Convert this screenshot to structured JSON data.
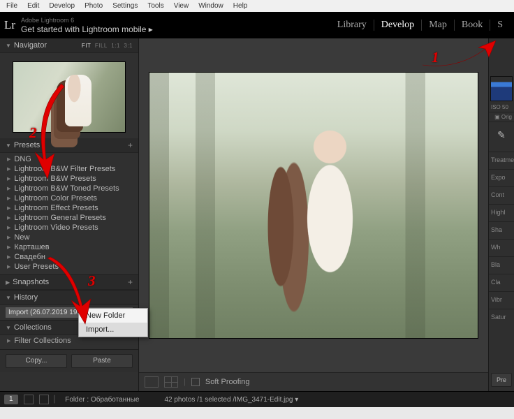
{
  "menubar": [
    "File",
    "Edit",
    "Develop",
    "Photo",
    "Settings",
    "Tools",
    "View",
    "Window",
    "Help"
  ],
  "brand": {
    "product": "Adobe Lightroom 6",
    "tagline": "Get started with Lightroom mobile ▸"
  },
  "modules": {
    "items": [
      "Library",
      "Develop",
      "Map",
      "Book",
      "S"
    ],
    "active": "Develop"
  },
  "navigator": {
    "title": "Navigator",
    "options": [
      "FIT",
      "FILL",
      "1:1",
      "3:1"
    ],
    "selected": "FIT"
  },
  "presets": {
    "title": "Presets",
    "items": [
      "DNG",
      "Lightroom B&W Filter Presets",
      "Lightroom B&W Presets",
      "Lightroom B&W Toned Presets",
      "Lightroom Color Presets",
      "Lightroom Effect Presets",
      "Lightroom General Presets",
      "Lightroom Video Presets",
      "New",
      "Карташев",
      "Свадебн",
      "User Presets"
    ]
  },
  "context_menu": {
    "items": [
      "New Folder",
      "Import..."
    ],
    "highlight": "Import..."
  },
  "snapshots": {
    "title": "Snapshots"
  },
  "history": {
    "title": "History",
    "entry": "Import (26.07.2019 19:53:19)"
  },
  "collections": {
    "title": "Collections",
    "filter": "Filter Collections"
  },
  "left_buttons": {
    "copy": "Copy...",
    "paste": "Paste"
  },
  "center_toolbar": {
    "soft_proof": "Soft Proofing"
  },
  "right_panel": {
    "iso": "ISO 50",
    "orig": "Orig",
    "treat": "Treatme",
    "labels": [
      "Expo",
      "Cont",
      "Highl",
      "Sha",
      "Wh",
      "Bla",
      "Cla",
      "Vibr",
      "Satur"
    ],
    "btn": "Pre"
  },
  "filmstrip": {
    "counter": "1",
    "folder_label": "Folder : Обработанные",
    "status": "42 photos /1 selected /IMG_3471-Edit.jpg ▾"
  },
  "annotations": {
    "n1": "1",
    "n2": "2",
    "n3": "3"
  }
}
